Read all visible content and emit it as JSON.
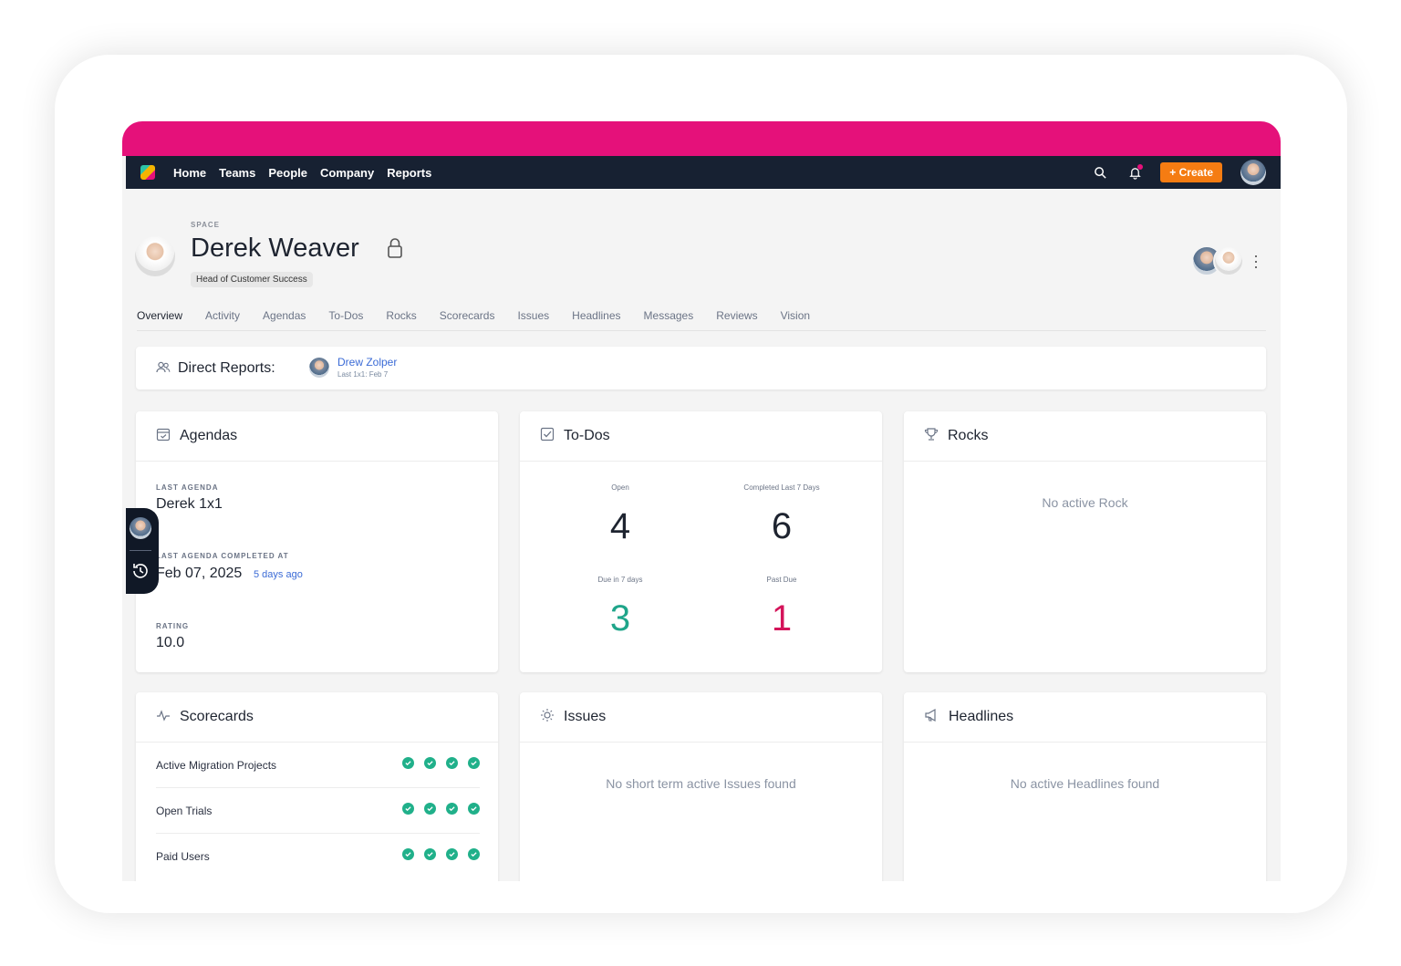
{
  "nav": {
    "links": [
      "Home",
      "Teams",
      "People",
      "Company",
      "Reports"
    ],
    "create_label": "+ Create"
  },
  "header": {
    "space_label": "SPACE",
    "name": "Derek Weaver",
    "role": "Head of Customer Success"
  },
  "tabs": [
    "Overview",
    "Activity",
    "Agendas",
    "To-Dos",
    "Rocks",
    "Scorecards",
    "Issues",
    "Headlines",
    "Messages",
    "Reviews",
    "Vision"
  ],
  "direct_reports": {
    "label": "Direct Reports:",
    "reports": [
      {
        "name": "Drew Zolper",
        "meta": "Last 1x1:  Feb 7"
      }
    ]
  },
  "agendas": {
    "title": "Agendas",
    "last_agenda_label": "LAST AGENDA",
    "last_agenda": "Derek 1x1",
    "completed_label": "LAST AGENDA COMPLETED AT",
    "completed_date": "Feb 07, 2025",
    "completed_ago": "5 days ago",
    "rating_label": "RATING",
    "rating": "10.0"
  },
  "todos": {
    "title": "To-Dos",
    "open_label": "Open",
    "open": "4",
    "completed_label": "Completed Last 7 Days",
    "completed": "6",
    "due_label": "Due in 7 days",
    "due": "3",
    "past_due_label": "Past Due",
    "past_due": "1"
  },
  "rocks": {
    "title": "Rocks",
    "empty": "No active Rock"
  },
  "scorecards": {
    "title": "Scorecards",
    "rows": [
      {
        "name": "Active Migration Projects",
        "checks": 4
      },
      {
        "name": "Open Trials",
        "checks": 4
      },
      {
        "name": "Paid Users",
        "checks": 4
      }
    ]
  },
  "issues": {
    "title": "Issues",
    "empty": "No short term active Issues found"
  },
  "headlines": {
    "title": "Headlines",
    "empty": "No active Headlines found"
  },
  "colors": {
    "accent_bar": "#e5117a",
    "nav_bg": "#172132",
    "create_btn": "#f57c12",
    "due_color": "#1fa58a",
    "past_due_color": "#d4145a",
    "check_color": "#20b08a"
  },
  "icons": [
    "search-icon",
    "bell-icon",
    "lock-icon",
    "people-icon",
    "calendar-icon",
    "checkbox-icon",
    "trophy-icon",
    "pulse-icon",
    "sun-icon",
    "megaphone-icon",
    "history-icon",
    "more-vertical-icon"
  ]
}
